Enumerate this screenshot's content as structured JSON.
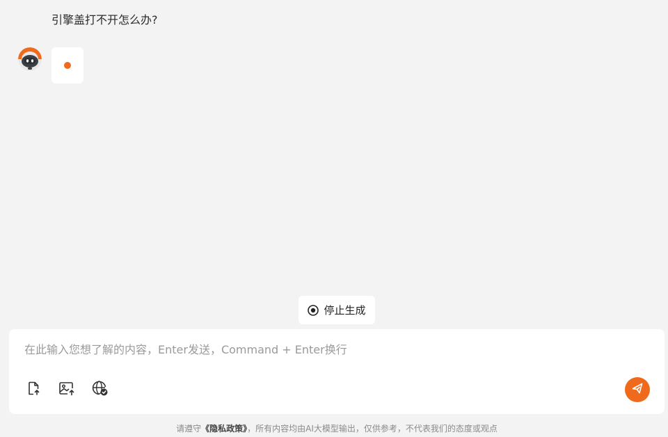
{
  "conversation": {
    "user_message": "引擎盖打不开怎么办?"
  },
  "controls": {
    "stop_label": "停止生成"
  },
  "composer": {
    "placeholder": "在此输入您想了解的内容，Enter发送，Command + Enter换行",
    "value": ""
  },
  "footer": {
    "prefix": "请遵守",
    "policy_link": "《隐私政策》",
    "suffix": "，所有内容均由AI大模型输出，仅供参考，不代表我们的态度或观点"
  },
  "colors": {
    "accent": "#f06a1d",
    "background": "#f2f3f2",
    "avatar_dark": "#3b3f44"
  },
  "icons": {
    "avatar": "robot-avatar-icon",
    "stop": "stop-circle-icon",
    "file": "file-upload-icon",
    "image": "image-upload-icon",
    "web": "web-search-icon",
    "send": "send-icon"
  }
}
